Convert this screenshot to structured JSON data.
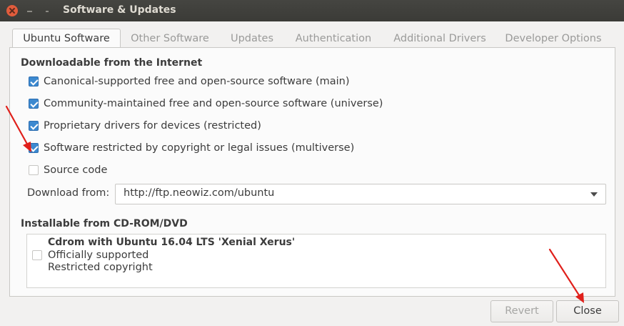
{
  "window": {
    "title": "Software & Updates"
  },
  "tabs": [
    {
      "label": "Ubuntu Software",
      "active": true
    },
    {
      "label": "Other Software",
      "active": false
    },
    {
      "label": "Updates",
      "active": false
    },
    {
      "label": "Authentication",
      "active": false
    },
    {
      "label": "Additional Drivers",
      "active": false
    },
    {
      "label": "Developer Options",
      "active": false
    }
  ],
  "internet": {
    "title": "Downloadable from the Internet",
    "options": [
      {
        "label": "Canonical-supported free and open-source software (main)",
        "checked": true
      },
      {
        "label": "Community-maintained free and open-source software (universe)",
        "checked": true
      },
      {
        "label": "Proprietary drivers for devices (restricted)",
        "checked": true
      },
      {
        "label": "Software restricted by copyright or legal issues (multiverse)",
        "checked": true
      },
      {
        "label": "Source code",
        "checked": false
      }
    ],
    "download_label": "Download from:",
    "download_value": "http://ftp.neowiz.com/ubuntu"
  },
  "cdrom": {
    "title": "Installable from CD-ROM/DVD",
    "name": "Cdrom with Ubuntu 16.04 LTS 'Xenial Xerus'",
    "line1": "Officially supported",
    "line2": "Restricted copyright",
    "checked": false
  },
  "buttons": {
    "revert": "Revert",
    "close": "Close"
  },
  "colors": {
    "accent": "#3c89d0",
    "titlebar": "#3b3b37",
    "annotation": "#e0201b"
  }
}
